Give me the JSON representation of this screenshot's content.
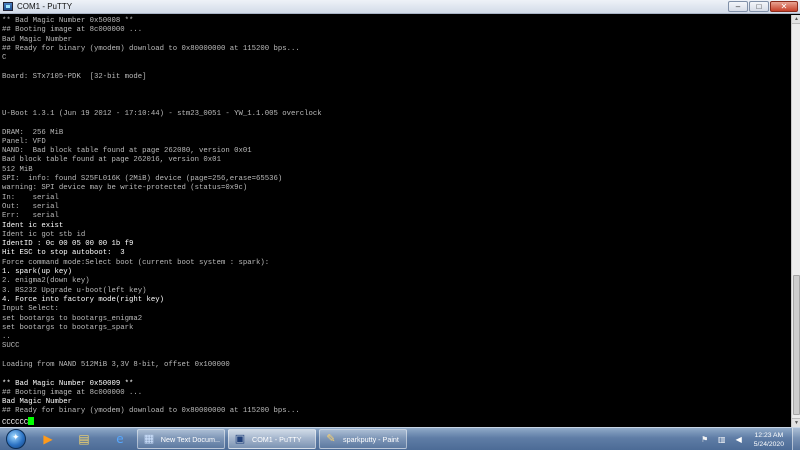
{
  "window": {
    "title": "COM1 - PuTTY",
    "controls": {
      "minimize": "–",
      "maximize": "□",
      "close": "✕"
    }
  },
  "terminal": {
    "lines": [
      "** Bad Magic Number 0x50008 **",
      "## Booting image at 8c000000 ...",
      "Bad Magic Number",
      "## Ready for binary (ymodem) download to 0x80000000 at 115200 bps...",
      "C",
      "",
      "Board: STx7105-PDK  [32-bit mode]",
      "",
      "",
      "",
      "U-Boot 1.3.1 (Jun 19 2012 - 17:10:44) - stm23_0051 - YW_1.1.005 overclock",
      "",
      "DRAM:  256 MiB",
      "Panel: VFD",
      "NAND:  Bad block table found at page 262080, version 0x01",
      "Bad block table found at page 262016, version 0x01",
      "512 MiB",
      "SPI:  info: found S25FL016K (2MiB) device (page=256,erase=65536)",
      "warning: SPI device may be write-protected (status=0x9c)",
      "In:    serial",
      "Out:   serial",
      "Err:   serial",
      "Ident ic exist",
      "Ident ic got stb id",
      "IdentID : 0c 00 05 00 00 1b f9",
      "Hit ESC to stop autoboot:  3",
      "Force command mode:Select boot (current boot system : spark):",
      "1. spark(up key)",
      "2. enigma2(down key)",
      "3. RS232 Upgrade u-boot(left key)",
      "4. Force into factory mode(right key)",
      "Input Select:",
      "set bootargs to bootargs_enigma2",
      "set bootargs to bootargs_spark",
      "..",
      "SUCC",
      "",
      "Loading from NAND 512MiB 3,3V 8-bit, offset 0x100000",
      "",
      "** Bad Magic Number 0x50009 **",
      "## Booting image at 8c000000 ...",
      "Bad Magic Number",
      "## Ready for binary (ymodem) download to 0x80000000 at 115200 bps...",
      "CCCCCC"
    ],
    "bright_lines": [
      22,
      24,
      25,
      27,
      30,
      39,
      41,
      43
    ],
    "right_value": "0",
    "cursor_color": "#00ff00"
  },
  "taskbar": {
    "pinned": [
      {
        "name": "media-player-icon",
        "glyph": "▶"
      },
      {
        "name": "folder-icon",
        "glyph": "▤"
      },
      {
        "name": "internet-explorer-icon",
        "glyph": "e"
      }
    ],
    "tasks": [
      {
        "label": "New Text Docum...",
        "icon": "notepad-icon",
        "glyph": "▦",
        "active": false
      },
      {
        "label": "COM1 - PuTTY",
        "icon": "putty-icon",
        "glyph": "▣",
        "active": true
      },
      {
        "label": "sparkputty - Paint",
        "icon": "paint-icon",
        "glyph": "✎",
        "active": false
      }
    ],
    "clock": {
      "time": "12:23 AM",
      "date": "5/24/2020"
    }
  }
}
